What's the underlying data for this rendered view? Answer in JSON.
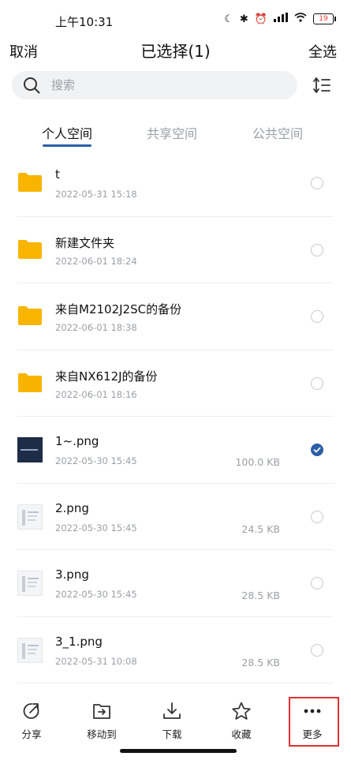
{
  "status": {
    "time": "上午10:31",
    "battery": "19"
  },
  "topbar": {
    "cancel": "取消",
    "title": "已选择(1)",
    "select_all": "全选"
  },
  "search": {
    "placeholder": "搜索"
  },
  "tabs": [
    {
      "label": "个人空间",
      "active": true
    },
    {
      "label": "共享空间",
      "active": false
    },
    {
      "label": "公共空间",
      "active": false
    }
  ],
  "files": [
    {
      "name": "t",
      "date": "2022-05-31 15:18",
      "size": "",
      "type": "folder",
      "checked": false
    },
    {
      "name": "新建文件夹",
      "date": "2022-06-01 18:24",
      "size": "",
      "type": "folder",
      "checked": false
    },
    {
      "name": "来自M2102J2SC的备份",
      "date": "2022-06-01 18:38",
      "size": "",
      "type": "folder",
      "checked": false
    },
    {
      "name": "来自NX612J的备份",
      "date": "2022-06-01 18:16",
      "size": "",
      "type": "folder",
      "checked": false
    },
    {
      "name": "1~.png",
      "date": "2022-05-30 15:45",
      "size": "100.0 KB",
      "type": "image-dark",
      "checked": true
    },
    {
      "name": "2.png",
      "date": "2022-05-30 15:45",
      "size": "24.5 KB",
      "type": "image-light",
      "checked": false
    },
    {
      "name": "3.png",
      "date": "2022-05-30 15:45",
      "size": "28.5 KB",
      "type": "image-light",
      "checked": false
    },
    {
      "name": "3_1.png",
      "date": "2022-05-31 10:08",
      "size": "28.5 KB",
      "type": "image-light",
      "checked": false
    }
  ],
  "bottom": {
    "share": "分享",
    "move": "移动到",
    "download": "下载",
    "favorite": "收藏",
    "more": "更多"
  },
  "colors": {
    "accent": "#2b5fa6",
    "folder": "#f7b500",
    "highlight": "#e03131"
  }
}
